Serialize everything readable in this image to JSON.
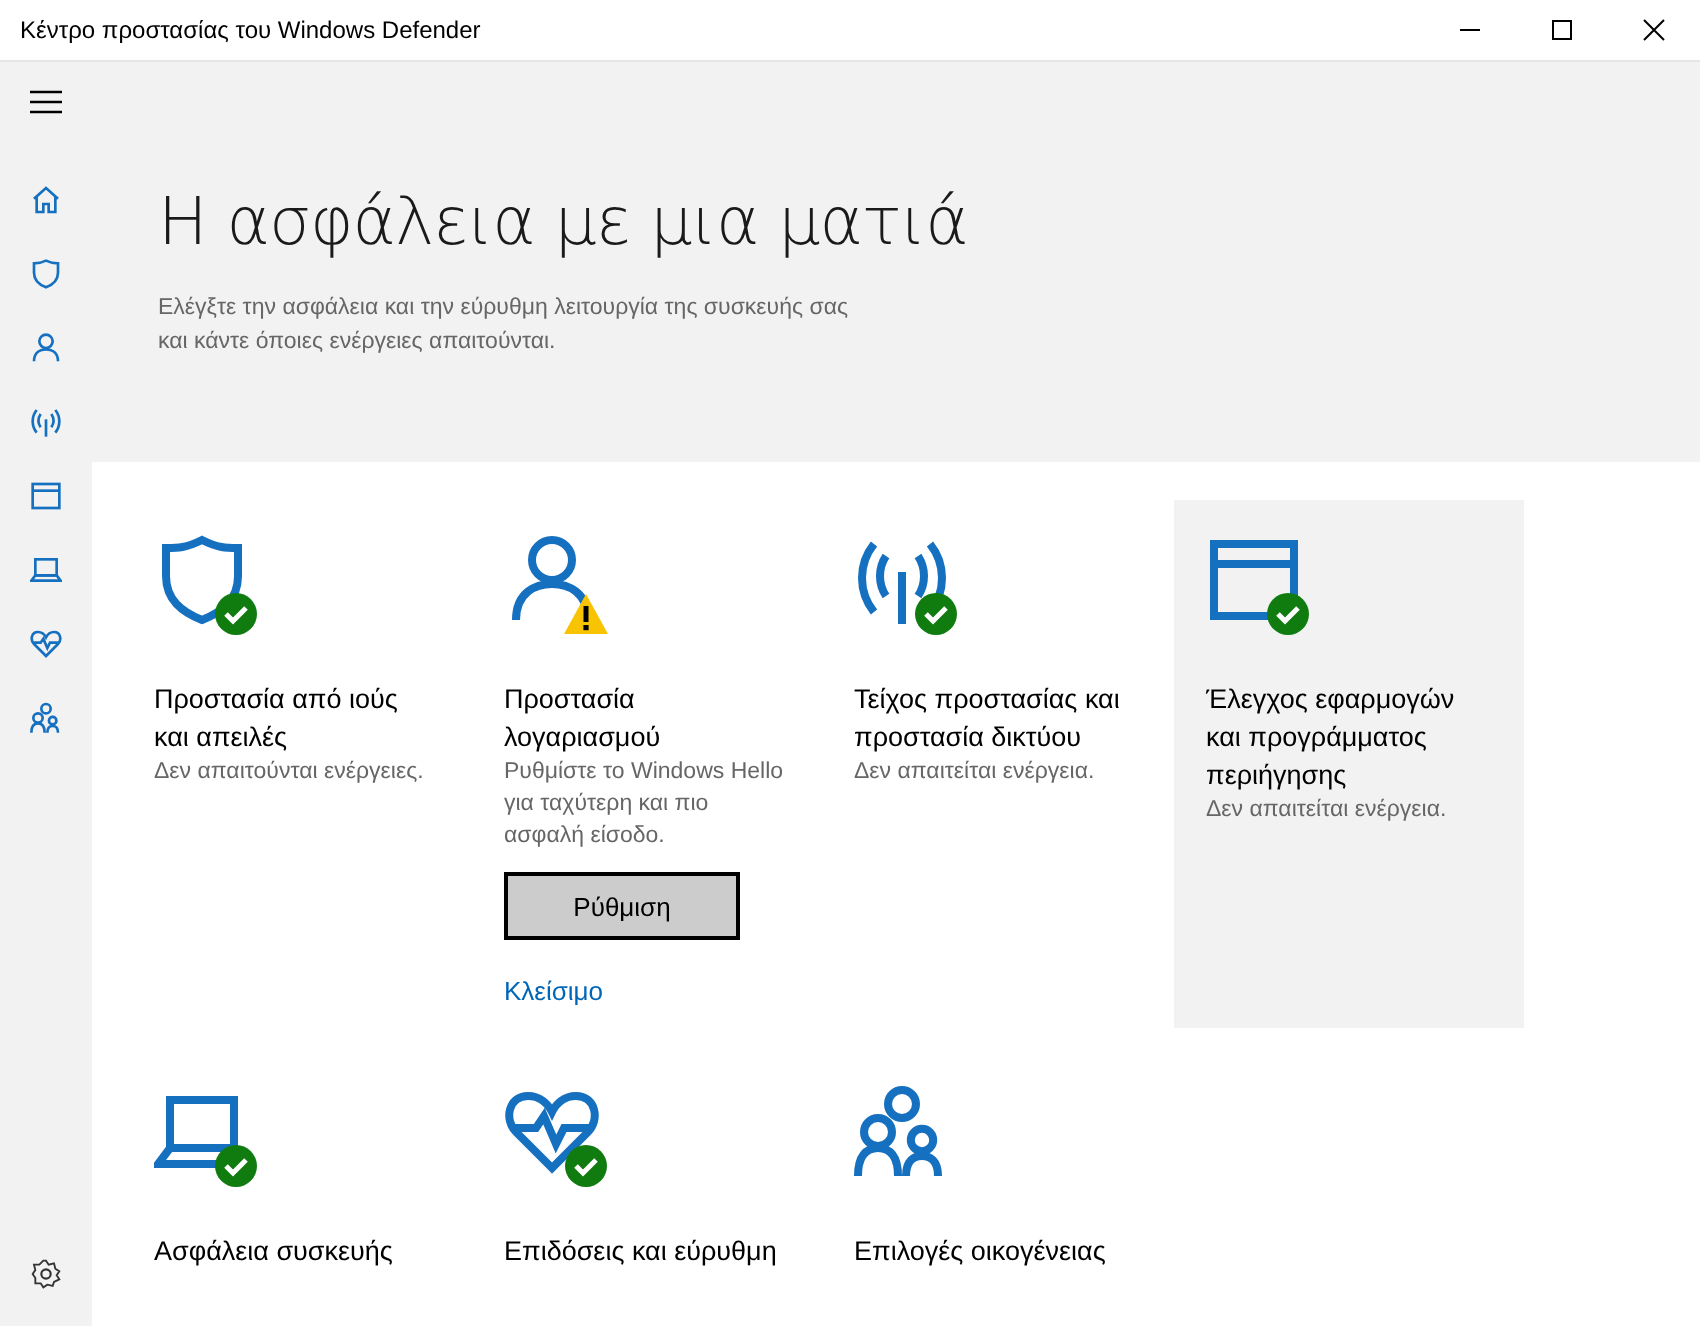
{
  "window": {
    "title": "Κέντρο προστασίας του Windows Defender"
  },
  "sidebar": {
    "items": [
      {
        "kind": "home"
      },
      {
        "kind": "shield"
      },
      {
        "kind": "person"
      },
      {
        "kind": "wifi"
      },
      {
        "kind": "browser"
      },
      {
        "kind": "laptop"
      },
      {
        "kind": "heart"
      },
      {
        "kind": "family"
      }
    ]
  },
  "header": {
    "title": "Η ασφάλεια με μια ματιά",
    "description": "Ελέγξτε την ασφάλεια και την εύρυθμη λειτουργία της συσκευής σας και κάντε όποιες ενέργειες απαιτούνται."
  },
  "tiles": [
    {
      "kind": "shield",
      "badge": {
        "kind": "check"
      },
      "selected": false,
      "title": "Προστασία από ιούς και απειλές",
      "subtitle": "Δεν απαιτούνται ενέργειες."
    },
    {
      "kind": "person",
      "badge": {
        "kind": "warning"
      },
      "selected": false,
      "title": "Προστασία λογαριασμού",
      "subtitle": "Ρυθμίστε το Windows Hello για ταχύτερη και πιο ασφαλή είσοδο.",
      "button": "Ρύθμιση",
      "link": "Κλείσιμο"
    },
    {
      "kind": "wifi",
      "badge": {
        "kind": "check"
      },
      "selected": false,
      "title": "Τείχος προστασίας και προστασία δικτύου",
      "subtitle": "Δεν απαιτείται ενέργεια."
    },
    {
      "kind": "browser",
      "badge": {
        "kind": "check"
      },
      "selected": true,
      "title": "Έλεγχος εφαρμογών και προγράμματος περιήγησης",
      "subtitle": "Δεν απαιτείται ενέργεια."
    },
    {
      "kind": "laptop",
      "badge": {
        "kind": "check"
      },
      "selected": false,
      "title": "Ασφάλεια συσκευής"
    },
    {
      "kind": "heart",
      "badge": {
        "kind": "check"
      },
      "selected": false,
      "title": "Επιδόσεις και εύρυθμη"
    },
    {
      "kind": "family",
      "selected": false,
      "title": "Επιλογές οικογένειας"
    }
  ]
}
